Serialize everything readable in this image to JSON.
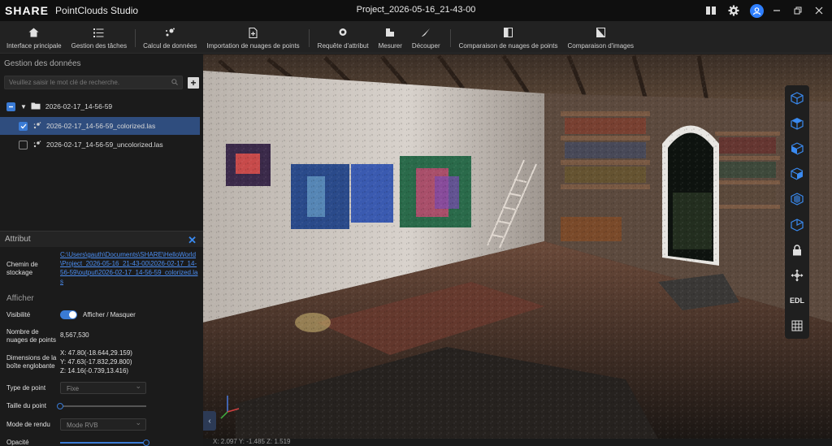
{
  "app": {
    "brand": "SHARE",
    "name": "PointClouds Studio",
    "project_title": "Project_2026-05-16_21-43-00"
  },
  "titlebar_icons": [
    "book-icon",
    "gear-icon",
    "user-avatar-icon",
    "minimize-icon",
    "restore-icon",
    "close-icon"
  ],
  "toolbar": {
    "items": [
      {
        "label": "Interface principale",
        "icon": "home-icon"
      },
      {
        "label": "Gestion des tâches",
        "icon": "task-list-icon"
      },
      {
        "label": "Calcul de données",
        "icon": "compute-icon"
      },
      {
        "label": "Importation de nuages de points",
        "icon": "file-import-icon"
      },
      {
        "label": "Requête d'attribut",
        "icon": "attribute-query-icon"
      },
      {
        "label": "Mesurer",
        "icon": "measure-icon"
      },
      {
        "label": "Découper",
        "icon": "cut-icon"
      },
      {
        "label": "Comparaison de nuages de points",
        "icon": "compare-clouds-icon"
      },
      {
        "label": "Comparaison d'images",
        "icon": "compare-images-icon"
      }
    ]
  },
  "data_panel": {
    "title": "Gestion des données",
    "search_placeholder": "Veuillez saisir le mot clé de recherche.",
    "tree": {
      "folder": "2026-02-17_14-56-59",
      "files": [
        {
          "name": "2026-02-17_14-56-59_colorized.las",
          "checked": true,
          "selected": true
        },
        {
          "name": "2026-02-17_14-56-59_uncolorized.las",
          "checked": false,
          "selected": false
        }
      ]
    }
  },
  "attributes": {
    "title": "Attribut",
    "path_label": "Chemin de stockage",
    "path_value": "C:\\Users\\gauth\\Documents\\SHARE\\HelloWorld\\Project_2026-05-16_21-43-00\\2026-02-17_14-56-59\\output\\2026-02-17_14-56-59_colorized.las",
    "display_section": "Afficher",
    "visibility_label": "Visibilité",
    "visibility_toggle_label": "Afficher / Masquer",
    "visibility_on": true,
    "count_label": "Nombre de nuages de points",
    "count_value": "8,567,530",
    "bbox_label": "Dimensions de la boîte englobante",
    "bbox_x": "X: 47.80(-18.644,29.159)",
    "bbox_y": "Y: 47.63(-17.832,29.800)",
    "bbox_z": "Z: 14.16(-0.739,13.416)",
    "point_type_label": "Type de point",
    "point_type_value": "Fixe",
    "point_size_label": "Taille du point",
    "point_size_fraction": 0.0,
    "render_mode_label": "Mode de rendu",
    "render_mode_value": "Mode RVB",
    "opacity_label": "Opacité",
    "opacity_fraction": 1.0
  },
  "viewport": {
    "coords": "X: 2.097   Y: -1.485   Z: 1.519",
    "right_tools": [
      "cube-view-iso-icon",
      "cube-view-top-icon",
      "cube-view-front-icon",
      "cube-view-left-icon",
      "cube-view-right-icon",
      "cube-view-back-icon",
      "lock-icon",
      "move-icon",
      "edl-button",
      "grid-icon"
    ],
    "edl_label": "EDL"
  }
}
